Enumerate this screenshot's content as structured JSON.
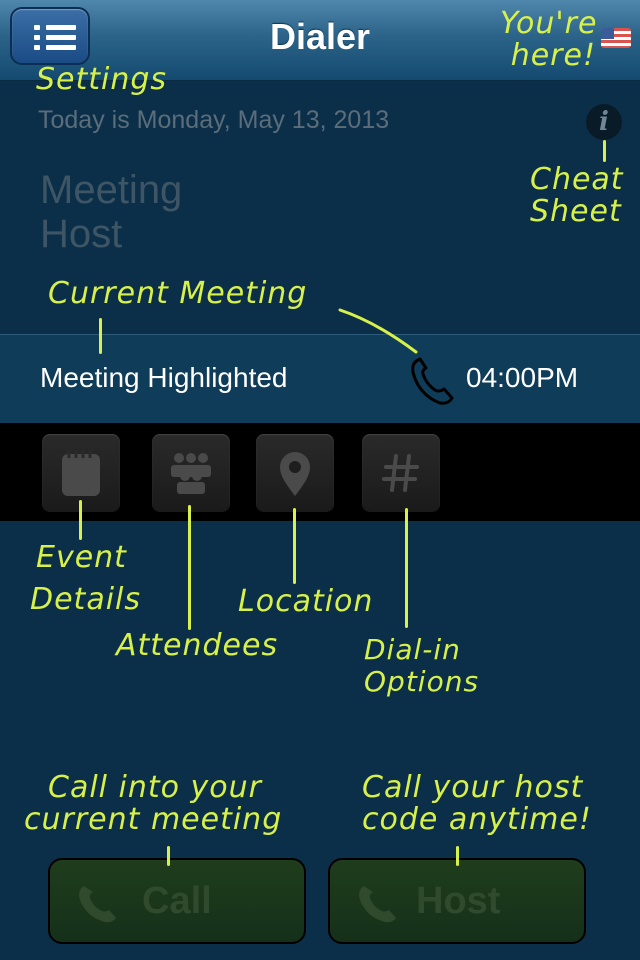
{
  "header": {
    "title": "Dialer",
    "menu_icon": "list-icon",
    "flag_icon": "us-flag-icon"
  },
  "status": {
    "date_text": "Today is Monday, May 13, 2013"
  },
  "host_section": {
    "heading_line1": "Meeting",
    "heading_line2": "Host"
  },
  "current_meeting": {
    "name": "Meeting Highlighted",
    "time": "04:00PM",
    "icon": "phone-icon"
  },
  "action_tiles": [
    {
      "icon": "notepad-icon"
    },
    {
      "icon": "attendees-icon"
    },
    {
      "icon": "location-pin-icon"
    },
    {
      "icon": "hash-icon"
    }
  ],
  "buttons": {
    "call_label": "Call",
    "host_label": "Host"
  },
  "annotations": {
    "settings": "Settings",
    "youre_here_line1": "You're",
    "youre_here_line2": "here!",
    "cheat_line1": "Cheat",
    "cheat_line2": "Sheet",
    "current_meeting": "Current Meeting",
    "event_line1": "Event",
    "event_line2": "Details",
    "attendees": "Attendees",
    "location": "Location",
    "dialin_line1": "Dial-in",
    "dialin_line2": "Options",
    "call_line1": "Call into your",
    "call_line2": "current meeting",
    "host_line1": "Call your host",
    "host_line2": "code anytime!"
  },
  "colors": {
    "annotation": "#d8f04a",
    "background": "#0b2f48",
    "header": "#2c6389"
  }
}
